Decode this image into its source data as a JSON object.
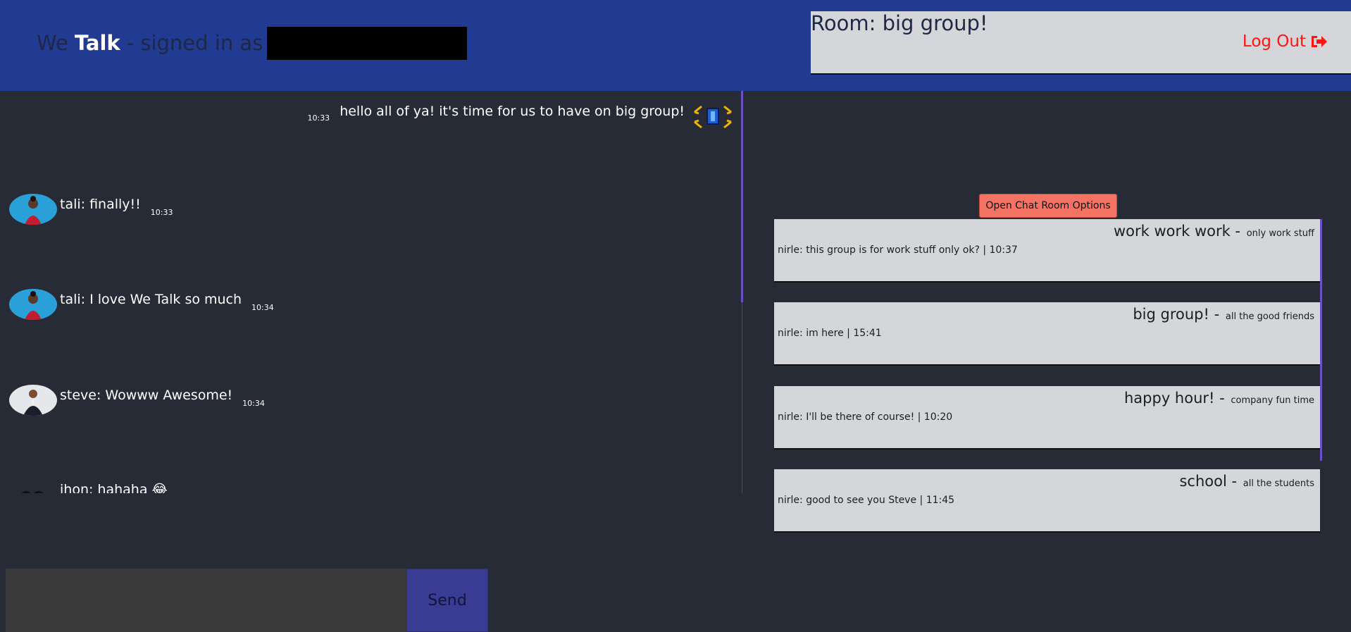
{
  "header": {
    "brand_we": "We",
    "brand_talk": "Talk",
    "signed_in_as": "- signed in as",
    "room_label": "Room: big group!",
    "logout_label": "Log Out"
  },
  "messages": [
    {
      "sender": "",
      "text": "hello all of ya! it's time for us to have on big group!",
      "time": "10:33",
      "own": true
    },
    {
      "sender": "tali",
      "text": "tali: finally!!",
      "time": "10:33"
    },
    {
      "sender": "tali",
      "text": "tali: I love We Talk so much",
      "time": "10:34"
    },
    {
      "sender": "steve",
      "text": "steve: Wowww Awesome!",
      "time": "10:34"
    },
    {
      "sender": "jhon",
      "text": "jhon: hahaha 😂",
      "time": ""
    }
  ],
  "composer": {
    "placeholder": "",
    "send_label": "Send"
  },
  "rooms_panel": {
    "options_label": "Open Chat Room Options",
    "rooms": [
      {
        "name": "work work work -",
        "description": "only work stuff",
        "last_message": "nirle: this group is for work stuff only ok? | 10:37"
      },
      {
        "name": "big group! -",
        "description": "all the good friends",
        "last_message": "nirle: im here | 15:41"
      },
      {
        "name": "happy hour! -",
        "description": "company fun time",
        "last_message": "nirle: I'll be there of course! | 10:20"
      },
      {
        "name": "school -",
        "description": "all the students",
        "last_message": "nirle: good to see you Steve | 11:45"
      }
    ]
  },
  "colors": {
    "header_bg": "#213a92",
    "page_bg": "#272b35",
    "logout": "#ff1414",
    "options_button": "#f57363",
    "send_button": "#3a3b92",
    "room_card": "#d5d6d9"
  }
}
